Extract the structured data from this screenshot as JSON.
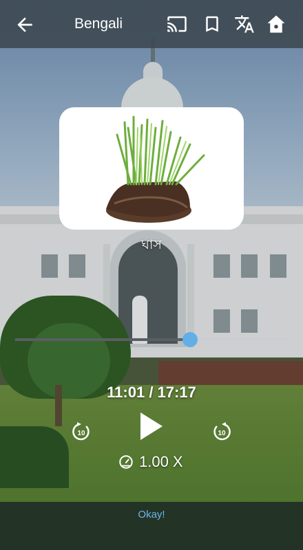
{
  "header": {
    "title": "Bengali"
  },
  "icons": {
    "back": "arrow-left-icon",
    "cast": "cast-icon",
    "bookmark": "bookmark-icon",
    "translate": "translate-icon",
    "home": "home-icon"
  },
  "card": {
    "word": "ঘাস",
    "image": "grass-clump-image"
  },
  "player": {
    "time": "11:01 / 17:17",
    "progress": 0.637,
    "speed": "1.00 X",
    "rewind_label": "10",
    "forward_label": "10"
  },
  "footer": {
    "okay_label": "Okay!"
  },
  "colors": {
    "accent": "#62aee6",
    "okay": "#6cb6e8"
  }
}
